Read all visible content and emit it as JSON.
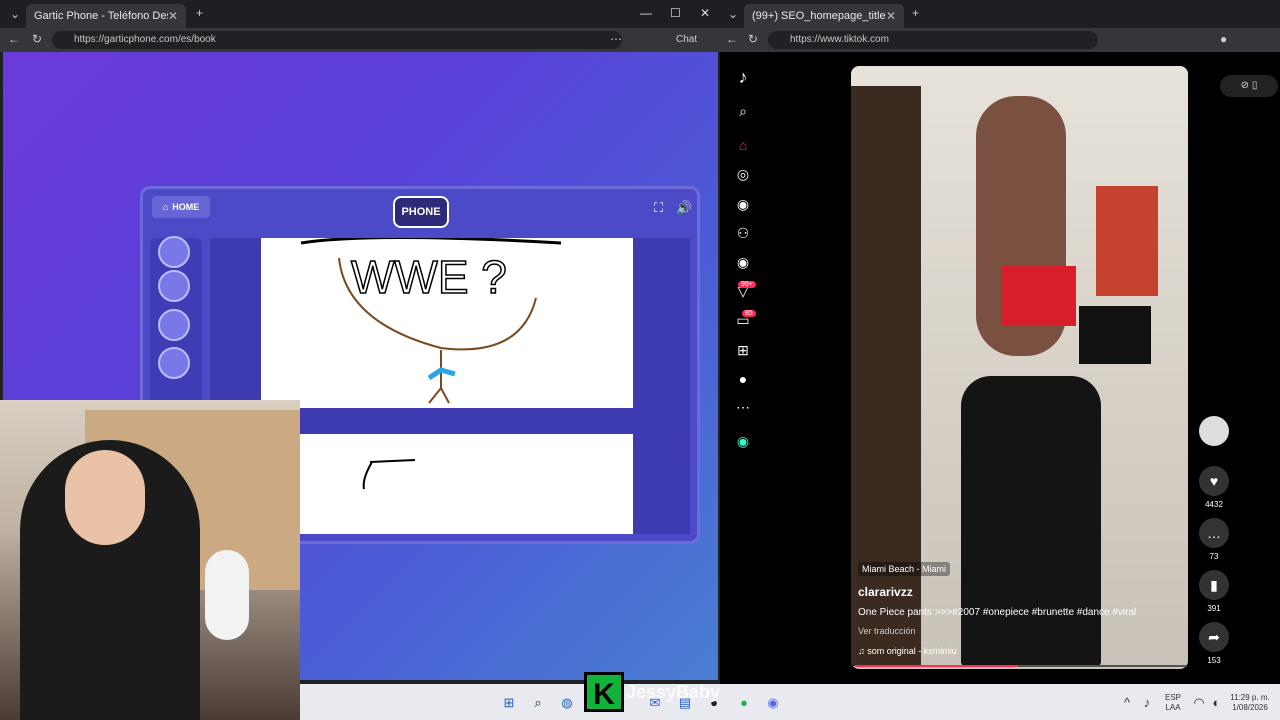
{
  "left_browser": {
    "tab_title": "Gartic Phone - Teléfono Descomp",
    "url": "https://garticphone.com/es/book",
    "chat_label": "Chat"
  },
  "gartic": {
    "home_label": "HOME",
    "logo_text": "PHONE",
    "drawing_text": "WWE ?"
  },
  "right_browser": {
    "tab_title": "(99+) SEO_homepage_title",
    "url": "https://www.tiktok.com"
  },
  "tiktok": {
    "badges": {
      "activity": "99+",
      "messages": "85"
    },
    "video": {
      "location": "Miami Beach - Miami",
      "username": "clararivzz",
      "description": "One Piece pants >>>#2007 #onepiece #brunette #dance #viral",
      "translate": "Ver traducción",
      "sound": "som original - ksmimiu",
      "progress": 0.49
    },
    "actions": {
      "likes": "4432",
      "comments": "73",
      "saves": "391",
      "shares": "153"
    }
  },
  "overlay": {
    "watermark": "JessyBaby",
    "logo_letter": "K"
  },
  "taskbar": {
    "lang_top": "ESP",
    "lang_bottom": "LAA",
    "time": "11:29 p. m.",
    "date": "1/08/2026"
  },
  "colors": {
    "tiktok_accent": "#fe2c55",
    "gartic_purple": "#4c4ac6"
  }
}
